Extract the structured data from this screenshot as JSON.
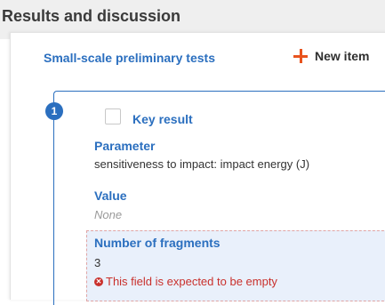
{
  "section": {
    "title": "Results and discussion"
  },
  "subsection": {
    "tab_label": "Small-scale preliminary tests",
    "new_item_label": "New item",
    "new_item_icon": "plus-icon",
    "accent_color": "#e8531e"
  },
  "item": {
    "index": "1",
    "key_result_label": "Key result",
    "key_result_checked": false,
    "fields": {
      "parameter": {
        "label": "Parameter",
        "value": "sensitiveness to impact: impact energy (J)"
      },
      "value": {
        "label": "Value",
        "value": "None"
      },
      "fragments": {
        "label": "Number of fragments",
        "value": "3",
        "error_icon": "error-circle-icon",
        "error": "This field is expected to be empty"
      }
    }
  },
  "colors": {
    "link_blue": "#2b6fbf",
    "error_red": "#c9302c",
    "highlight_bg": "#e9f0fb"
  }
}
